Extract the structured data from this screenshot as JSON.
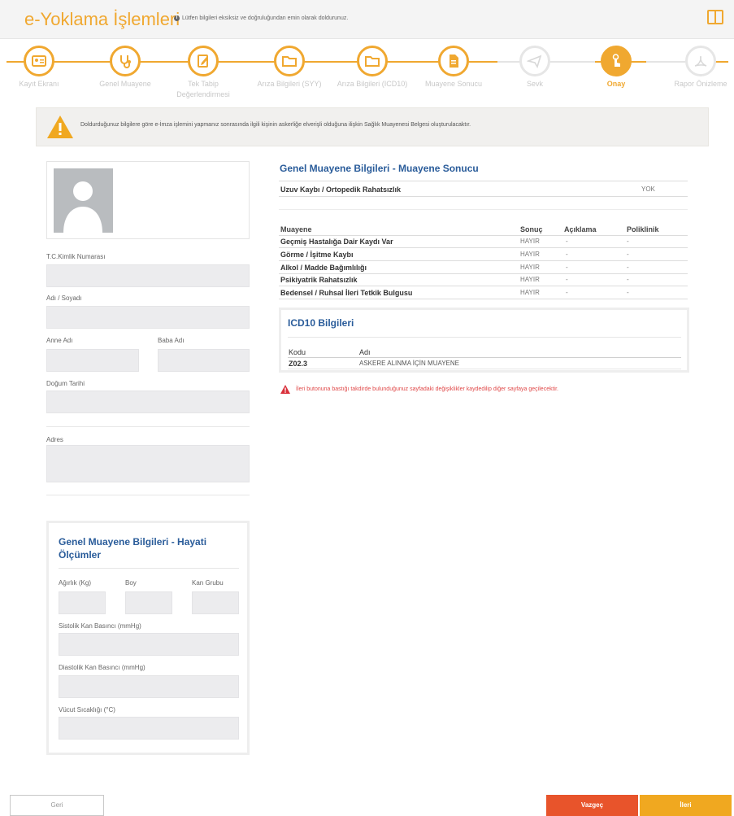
{
  "header": {
    "title": "e-Yoklama İşlemleri",
    "hint": "Lütfen bilgileri eksiksiz ve doğruluğundan emin olarak doldurunuz."
  },
  "steps": [
    {
      "label": "Kayıt Ekranı",
      "icon": "id-card-icon",
      "state": "done"
    },
    {
      "label": "Genel Muayene",
      "icon": "stethoscope-icon",
      "state": "done"
    },
    {
      "label": "Tek Tabip Değerlendirmesi",
      "icon": "clipboard-edit-icon",
      "state": "done"
    },
    {
      "label": "Arıza Bilgileri (SYY)",
      "icon": "folder-icon",
      "state": "done"
    },
    {
      "label": "Arıza Bilgileri (ICD10)",
      "icon": "folder-icon",
      "state": "done"
    },
    {
      "label": "Muayene Sonucu",
      "icon": "document-icon",
      "state": "done"
    },
    {
      "label": "Sevk",
      "icon": "paper-plane-icon",
      "state": "future"
    },
    {
      "label": "Onay",
      "icon": "hand-touch-icon",
      "state": "active"
    },
    {
      "label": "Rapor Önizleme",
      "icon": "pdf-icon",
      "state": "future"
    }
  ],
  "warning": "Doldurduğunuz bilgilere göre e-İmza işlemini yapmanız sonrasında ilgili kişinin askerliğe elverişli olduğuna ilişkin Sağlık Muayenesi Belgesi oluşturulacaktır.",
  "person": {
    "tc_label": "T.C.Kimlik Numarası",
    "name_label": "Adı / Soyadı",
    "mother_label": "Anne Adı",
    "father_label": "Baba Adı",
    "birth_label": "Doğum Tarihi",
    "address_label": "Adres"
  },
  "vitals": {
    "title": "Genel Muayene Bilgileri - Hayati Ölçümler",
    "weight_label": "Ağırlık (Kg)",
    "height_label": "Boy",
    "blood_label": "Kan Grubu",
    "systolic_label": "Sistolik Kan Basıncı (mmHg)",
    "diastolic_label": "Diastolik Kan Basıncı (mmHg)",
    "temp_label": "Vücut Sıcaklığı (°C)"
  },
  "result": {
    "title": "Genel Muayene Bilgileri - Muayene Sonucu",
    "limb_label": "Uzuv Kaybı / Ortopedik Rahatsızlık",
    "limb_value": "YOK",
    "columns": [
      "Muayene",
      "Sonuç",
      "Açıklama",
      "Poliklinik"
    ],
    "rows": [
      {
        "name": "Geçmiş Hastalığa Dair Kaydı Var",
        "result": "HAYIR",
        "desc": "-",
        "clinic": "-"
      },
      {
        "name": "Görme / İşitme Kaybı",
        "result": "HAYIR",
        "desc": "-",
        "clinic": "-"
      },
      {
        "name": "Alkol / Madde Bağımlılığı",
        "result": "HAYIR",
        "desc": "-",
        "clinic": "-"
      },
      {
        "name": "Psikiyatrik Rahatsızlık",
        "result": "HAYIR",
        "desc": "-",
        "clinic": "-"
      },
      {
        "name": "Bedensel / Ruhsal İleri Tetkik Bulgusu",
        "result": "HAYIR",
        "desc": "-",
        "clinic": "-"
      }
    ]
  },
  "icd": {
    "title": "ICD10 Bilgileri",
    "col_code": "Kodu",
    "col_name": "Adı",
    "code": "Z02.3",
    "name": "ASKERE ALINMA İÇİN MUAYENE"
  },
  "error_text": "İleri butonuna bastığı takdirde bulunduğunuz sayfadaki değişiklikler kaydedilip diğer sayfaya geçilecektir.",
  "buttons": {
    "back": "Geri",
    "cancel": "Vazgeç",
    "next": "İleri"
  },
  "colors": {
    "accent": "#f0a830",
    "title_blue": "#2a5c9a",
    "danger": "#e8542b",
    "error_text": "#e04a4a"
  }
}
